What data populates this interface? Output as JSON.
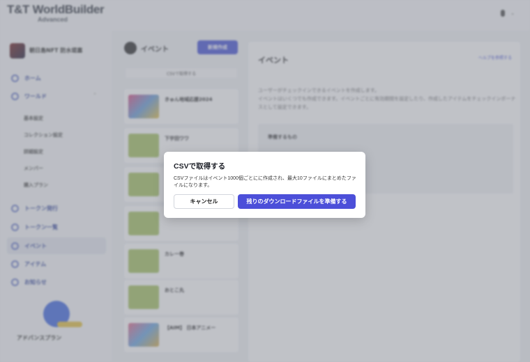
{
  "app": {
    "logo": "T&T WorldBuilder",
    "edition": "Advanced",
    "user": "",
    "accent": "#4c4fd9"
  },
  "sidebar": {
    "project_name": "朝日島NFT 防水堤塞",
    "project_sub": "",
    "items": [
      {
        "label": "ホーム",
        "icon": "home-icon"
      },
      {
        "label": "ワールド",
        "icon": "globe-icon"
      },
      {
        "label": "トークン発行",
        "icon": "mint-icon"
      },
      {
        "label": "トークン一覧",
        "icon": "list-icon"
      },
      {
        "label": "イベント",
        "icon": "calendar-icon"
      },
      {
        "label": "アイテム",
        "icon": "item-icon"
      },
      {
        "label": "お知らせ",
        "icon": "bell-icon"
      }
    ],
    "sub_items": [
      "基本設定",
      "コレクション設定",
      "詳細設定",
      "メンバー",
      "購入プラン"
    ],
    "promo_title": "アドバンスプラン",
    "promo_link": ""
  },
  "list": {
    "title": "イベント",
    "new_button": "新規作成",
    "csv_link": "CSVで取得する",
    "cards": [
      {
        "title": "きゅん地域応援2024",
        "meta": ""
      },
      {
        "title": "下宇田ワワ",
        "meta": ""
      },
      {
        "title": "",
        "meta": ""
      },
      {
        "title": "",
        "meta": ""
      },
      {
        "title": "カレー巻",
        "meta": ""
      },
      {
        "title": "おとこ丸",
        "meta": ""
      },
      {
        "title": "【AIM】 日本アニメー",
        "meta": ""
      }
    ]
  },
  "detail": {
    "title": "イベント",
    "help_link": "ヘルプを参照する",
    "desc_line1": "ユーザーがチェックインできるイベントを作成します。",
    "desc_line2": "イベントはいくつでも作成できます。イベントごとに有効期間を設定したり、作成したアイテムをチェックインボーナスとして設定できます。",
    "prep_title": "準備するもの"
  },
  "dialog": {
    "title": "CSVで取得する",
    "body": "CSVファイルはイベント1000個ごとにに作成され、最大10ファイルにまとめたファイルになります。",
    "cancel_label": "キャンセル",
    "confirm_label": "残りのダウンロードファイルを準備する"
  }
}
